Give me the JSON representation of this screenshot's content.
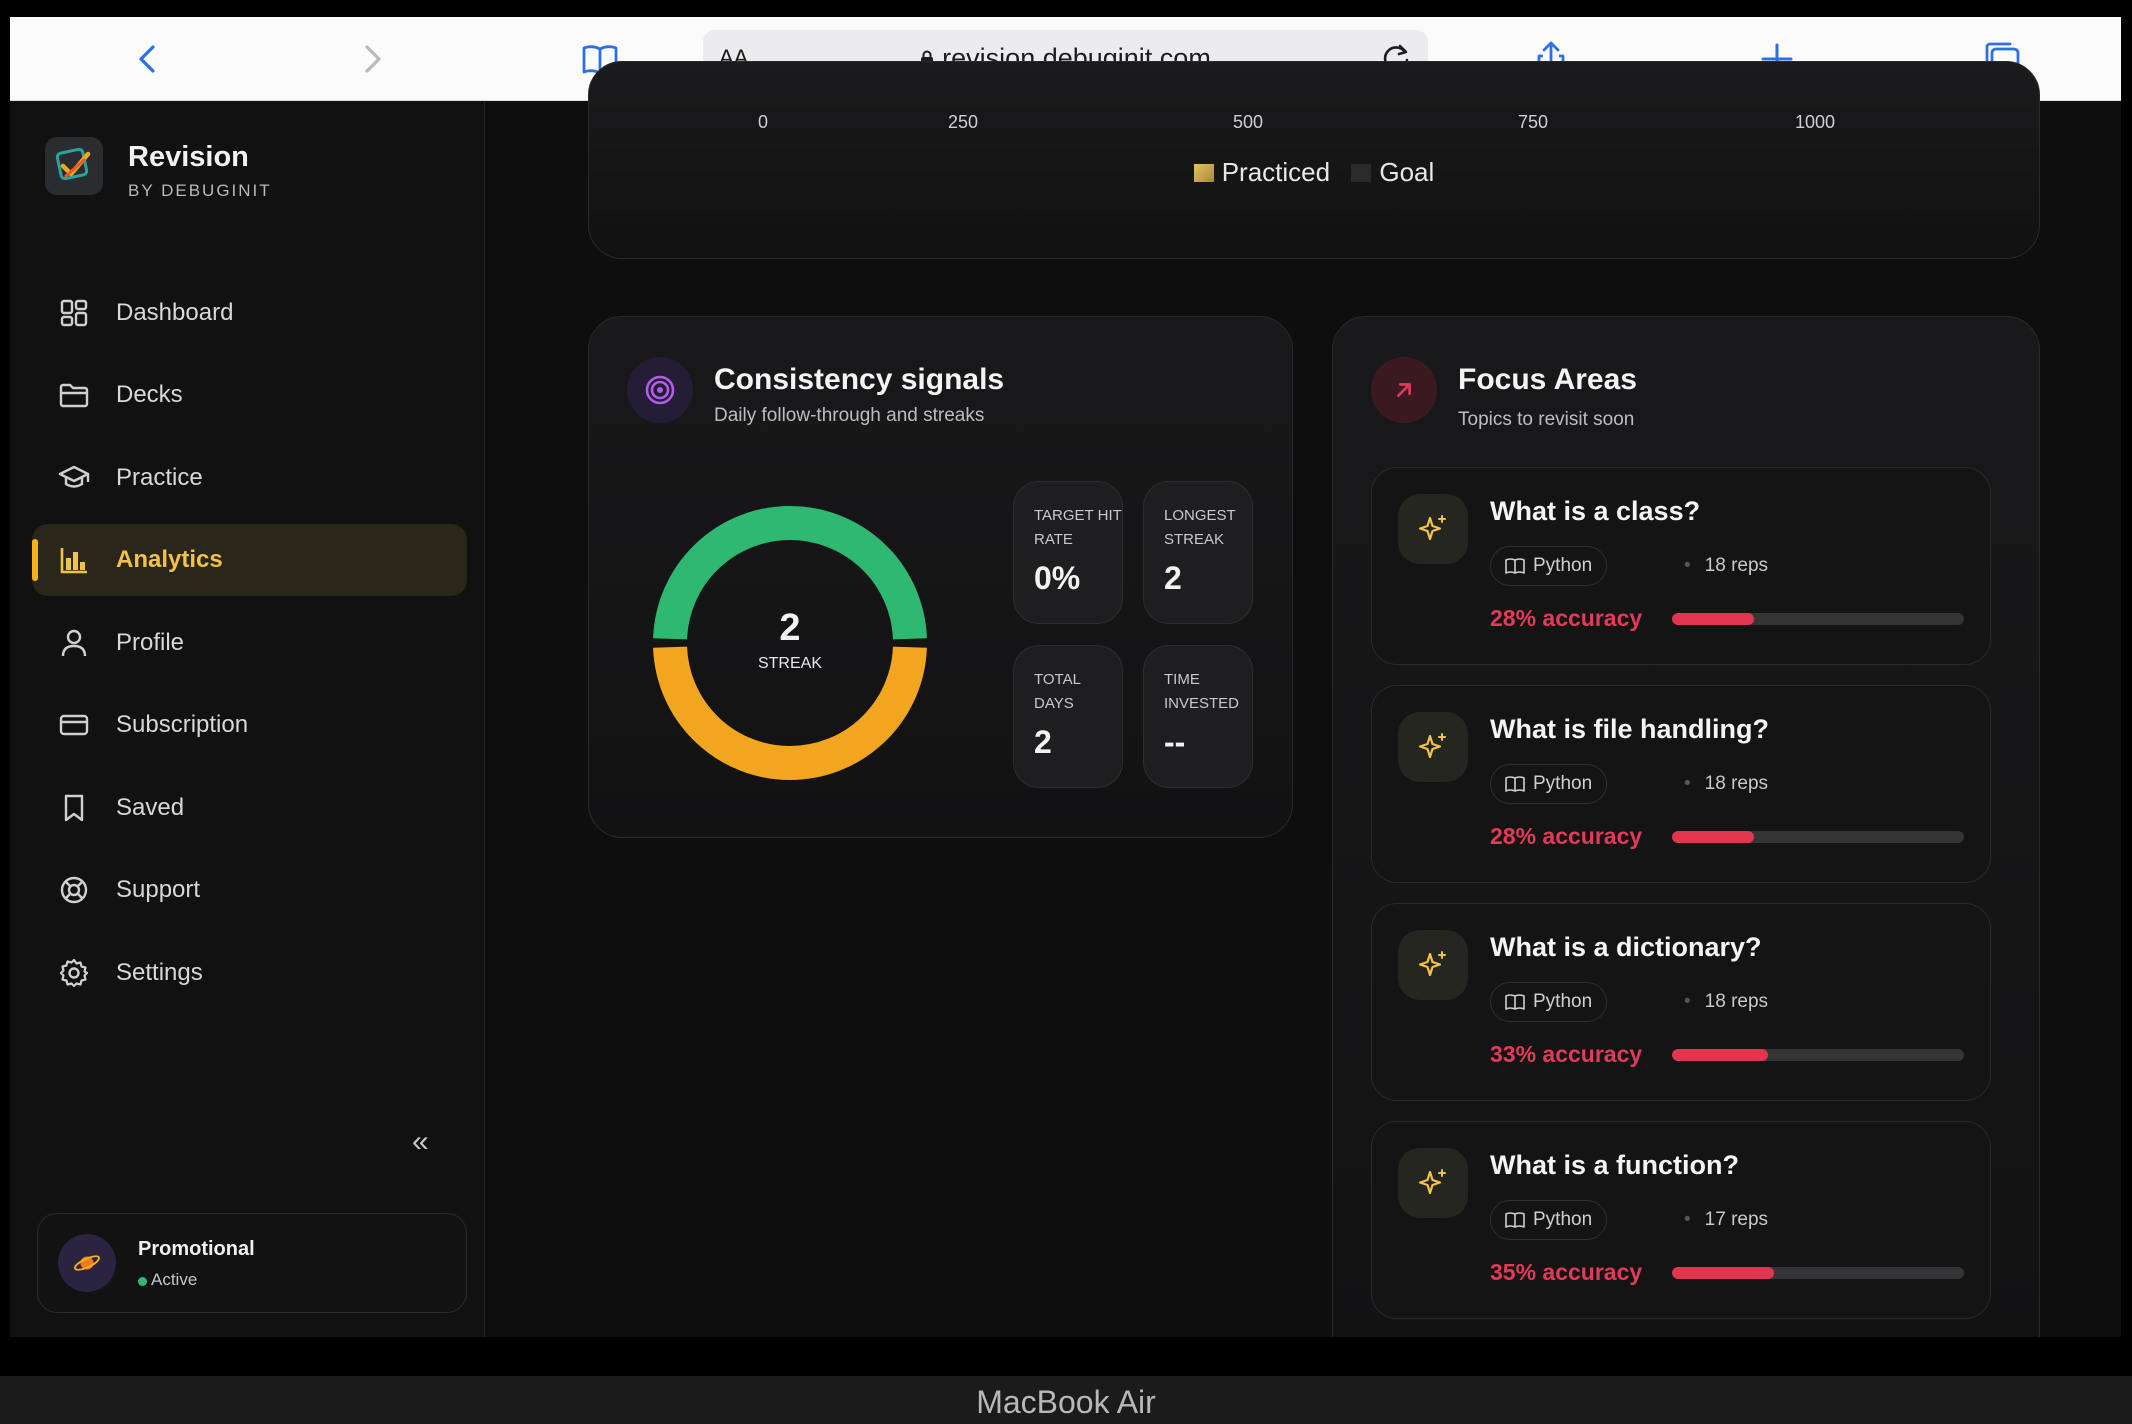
{
  "browser": {
    "aa_label": "AA",
    "url": "revision.debuginit.com"
  },
  "brand": {
    "name": "Revision",
    "subtitle": "BY DEBUGINIT"
  },
  "sidebar": {
    "items": [
      {
        "label": "Dashboard",
        "icon": "dashboard-icon"
      },
      {
        "label": "Decks",
        "icon": "folder-icon"
      },
      {
        "label": "Practice",
        "icon": "graduation-cap-icon"
      },
      {
        "label": "Analytics",
        "icon": "bar-chart-icon",
        "active": true
      },
      {
        "label": "Profile",
        "icon": "user-icon"
      },
      {
        "label": "Subscription",
        "icon": "credit-card-icon"
      },
      {
        "label": "Saved",
        "icon": "bookmark-icon"
      },
      {
        "label": "Support",
        "icon": "lifebuoy-icon"
      },
      {
        "label": "Settings",
        "icon": "gear-icon"
      }
    ],
    "collapse_glyph": "«",
    "promo": {
      "title": "Promotional",
      "status": "Active",
      "status_color": "#2eb872"
    }
  },
  "practice_chart": {
    "ticks": [
      "0",
      "250",
      "500",
      "750",
      "1000"
    ],
    "legend": [
      {
        "label": "Practiced",
        "color": "#c9a646"
      },
      {
        "label": "Goal",
        "color": "#2a2a2c"
      }
    ]
  },
  "consistency": {
    "title": "Consistency signals",
    "subtitle": "Daily follow-through and streaks",
    "streak_value": "2",
    "streak_label": "STREAK",
    "donut": {
      "green_fraction": 0.5,
      "green": "#2eb872",
      "amber": "#f2a51f"
    },
    "stats": [
      {
        "label": "Target hit rate",
        "value": "0%"
      },
      {
        "label": "Longest streak",
        "value": "2"
      },
      {
        "label": "Total days",
        "value": "2"
      },
      {
        "label": "Time invested",
        "value": "--"
      }
    ]
  },
  "focus": {
    "title": "Focus Areas",
    "subtitle": "Topics to revisit soon",
    "items": [
      {
        "question": "What is a class?",
        "topic": "Python",
        "reps": "18 reps",
        "accuracy": "28% accuracy",
        "accuracy_pct": 28
      },
      {
        "question": "What is file handling?",
        "topic": "Python",
        "reps": "18 reps",
        "accuracy": "28% accuracy",
        "accuracy_pct": 28
      },
      {
        "question": "What is a dictionary?",
        "topic": "Python",
        "reps": "18 reps",
        "accuracy": "33% accuracy",
        "accuracy_pct": 33
      },
      {
        "question": "What is a function?",
        "topic": "Python",
        "reps": "17 reps",
        "accuracy": "35% accuracy",
        "accuracy_pct": 35
      }
    ]
  },
  "device": {
    "label": "MacBook Air"
  },
  "colors": {
    "accent": "#f2b418",
    "danger": "#e23a58"
  }
}
